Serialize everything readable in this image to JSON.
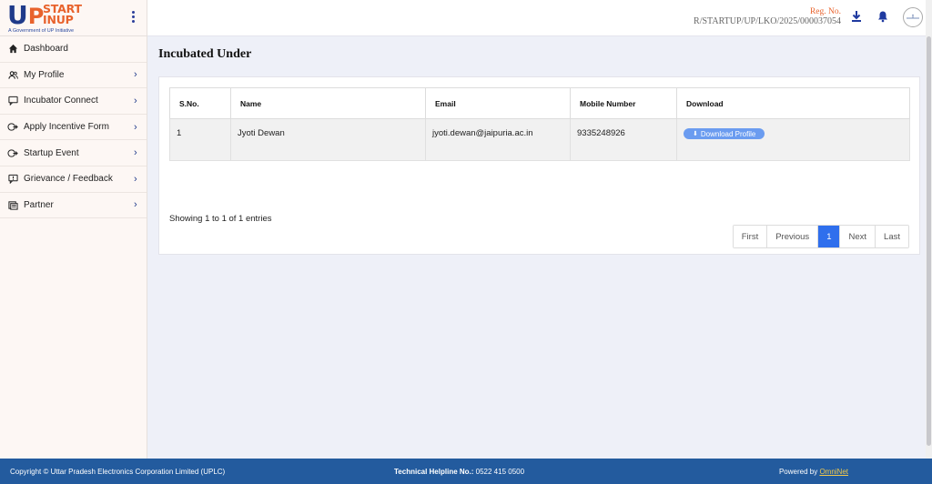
{
  "logo": {
    "u_letter": "U",
    "p_letter": "P",
    "line1": "START",
    "line2": "INUP",
    "tagline": "A Government of UP Initiative"
  },
  "sidebar": {
    "items": [
      {
        "label": "Dashboard",
        "icon": "home-icon",
        "has_chevron": false
      },
      {
        "label": "My Profile",
        "icon": "people-icon",
        "has_chevron": true
      },
      {
        "label": "Incubator Connect",
        "icon": "chat-icon",
        "has_chevron": true
      },
      {
        "label": "Apply Incentive Form",
        "icon": "form-icon",
        "has_chevron": true
      },
      {
        "label": "Startup Event",
        "icon": "event-icon",
        "has_chevron": true
      },
      {
        "label": "Grievance / Feedback",
        "icon": "feedback-icon",
        "has_chevron": true
      },
      {
        "label": "Partner",
        "icon": "partner-icon",
        "has_chevron": true
      }
    ]
  },
  "topbar": {
    "reg_label": "Reg. No.",
    "reg_number": "R/STARTUP/UP/LKO/2025/000037054"
  },
  "main": {
    "title": "Incubated Under",
    "table": {
      "headers": [
        "S.No.",
        "Name",
        "Email",
        "Mobile Number",
        "Download"
      ],
      "rows": [
        {
          "sno": "1",
          "name": "Jyoti Dewan",
          "email": "jyoti.dewan@jaipuria.ac.in",
          "mobile": "9335248926",
          "download_label": "Download Profile"
        }
      ]
    },
    "showing": "Showing 1 to 1 of 1 entries",
    "pager": {
      "first": "First",
      "previous": "Previous",
      "current": "1",
      "next": "Next",
      "last": "Last"
    }
  },
  "footer": {
    "copyright": "Copyright © Uttar Pradesh Electronics Corporation Limited (UPLC)",
    "helpline_label": "Technical Helpline No.:",
    "helpline_number": "0522 415 0500",
    "powered_by": "Powered by",
    "powered_link": "OmniNet"
  },
  "colors": {
    "brand_orange": "#e8622c",
    "brand_blue": "#1f3a8a",
    "footer_bg": "#235b9e",
    "button_blue": "#6b9cf0",
    "pager_active": "#2f6fed"
  }
}
